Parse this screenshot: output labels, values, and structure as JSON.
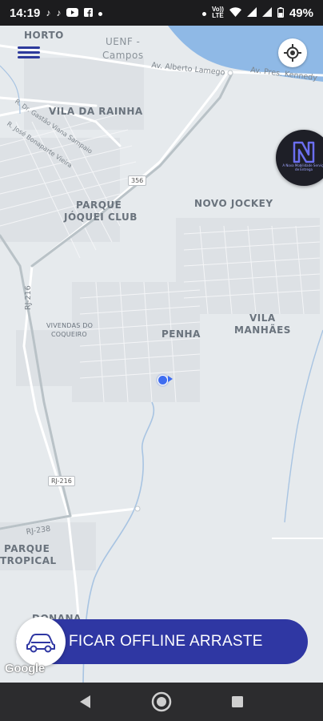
{
  "status_bar": {
    "time": "14:19",
    "left_icons": [
      "tiktok-icon",
      "tiktok-icon",
      "youtube-icon",
      "facebook-icon",
      "dot-icon"
    ],
    "right_icons": [
      "dot-icon",
      "volte-icon",
      "wifi-icon",
      "signal-icon",
      "signal-icon",
      "battery-icon"
    ],
    "volte_line1": "Vo))",
    "volte_line2": "LTE",
    "battery": "49%"
  },
  "map": {
    "labels": {
      "horto": "HORTO",
      "uenf": "UENF -",
      "campos": "Campos",
      "av_alberto": "Av. Alberto Lamego",
      "av_kennedy": "Av. Pres. Kennedy",
      "vila_rainha": "VILA DA RAINHA",
      "gastao": "R. Dr. Gastão Viana Sampaio",
      "jose": "R. José Bonaparte Vieira",
      "parque_jockey_1": "PARQUE",
      "parque_jockey_2": "JÓQUEI CLUB",
      "novo_jockey": "NOVO JOCKEY",
      "vivendas_1": "VIVENDAS DO",
      "vivendas_2": "COQUEIRO",
      "penha": "PENHA",
      "vila_manhaes_1": "VILA",
      "vila_manhaes_2": "MANHÃES",
      "rj216_road": "RJ-216",
      "rj238_road": "RJ-238",
      "parque_tropical_1": "PARQUE",
      "parque_tropical_2": "TROPICAL",
      "donana": "DONANA"
    },
    "shields": {
      "r356": "356",
      "rj216": "RJ-216"
    },
    "colors": {
      "background": "#e6eaed",
      "water": "#8fb9e6",
      "road": "#ffffff",
      "route": "#b9c2c7",
      "river": "#a8c4e2"
    }
  },
  "menu": {
    "icon": "hamburger-menu-icon"
  },
  "locate": {
    "icon": "crosshair-icon"
  },
  "brand_badge": {
    "icon": "brand-n-logo-icon",
    "tagline": "A Nova Mobilidade Serviço de Entrega"
  },
  "slider": {
    "label": "FICAR OFFLINE ARRASTE",
    "knob_icon": "car-icon"
  },
  "google": {
    "logo": "Google"
  },
  "nav": {
    "back_icon": "back-triangle-icon",
    "home_icon": "home-circle-icon",
    "recents_icon": "recents-square-icon"
  },
  "accent_color": "#2f37a3",
  "location_color": "#3f6df0"
}
